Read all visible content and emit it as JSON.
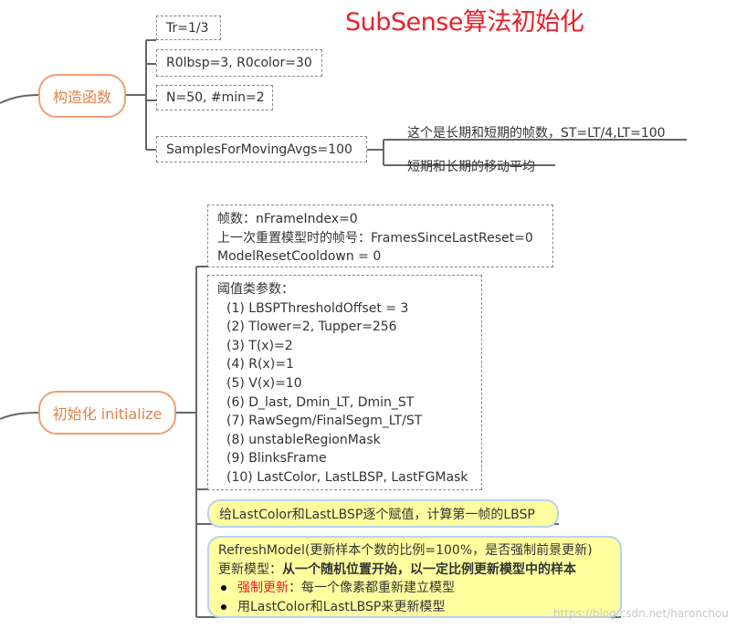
{
  "title": "SubSense算法初始化",
  "branches": {
    "constructor": {
      "label": "构造函数",
      "items": [
        "Tr=1/3",
        "R0lbsp=3, R0color=30",
        "N=50, #min=2",
        "SamplesForMovingAvgs=100"
      ],
      "notes": [
        "这个是长期和短期的帧数，ST=LT/4,LT=100",
        "短期和长期的移动平均"
      ]
    },
    "initialize": {
      "label": "初始化 initialize",
      "frame_box": [
        "帧数：nFrameIndex=0",
        "上一次重置模型时的帧号：FramesSinceLastReset=0",
        "ModelResetCooldown = 0"
      ],
      "threshold_box": {
        "header": "阈值类参数：",
        "items": [
          "(1)  LBSPThresholdOffset = 3",
          "(2)  Tlower=2, Tupper=256",
          "(3)  T(x)=2",
          "(4)  R(x)=1",
          "(5)  V(x)=10",
          "(6)  D_last, Dmin_LT, Dmin_ST",
          "(7)  RawSegm/FinalSegm_LT/ST",
          "(8)  unstableRegionMask",
          "(9)  BlinksFrame",
          "(10)  LastColor, LastLBSP, LastFGMask"
        ]
      },
      "assign_box": "给LastColor和LastLBSP逐个赋值，计算第一帧的LBSP",
      "refresh_box": {
        "line1": "RefreshModel(更新样本个数的比例=100%，是否强制前景更新)",
        "line2_prefix": "更新模型：",
        "line2_bold": "从一个随机位置开始，以一定比例更新模型中的样本",
        "bullet1_red": "强制更新",
        "bullet1_rest": "：每一个像素都重新建立模型",
        "bullet2": "用LastColor和LastLBSP来更新模型"
      }
    }
  },
  "watermark": "https://blog.csdn.net/haronchou",
  "colors": {
    "title": "#e8212b",
    "node_border": "#f0a070",
    "node_text": "#e0834a",
    "highlight_fill": "#ffffa0",
    "highlight_border": "#b8d2ee",
    "connector": "#666666"
  }
}
